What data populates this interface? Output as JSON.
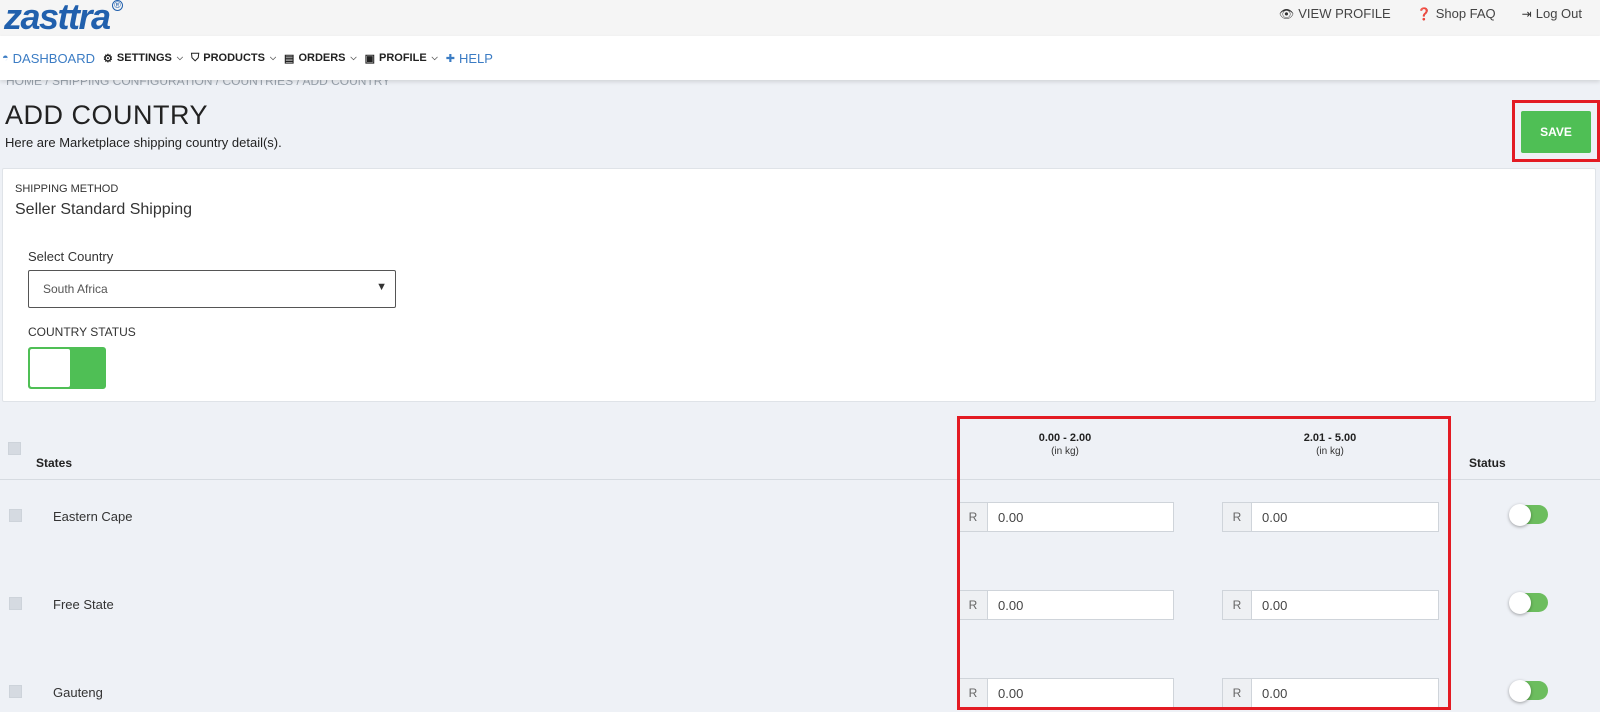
{
  "brand": {
    "name": "zasttra",
    "mark": "®"
  },
  "top_links": [
    {
      "icon": "eye-icon",
      "label": "VIEW PROFILE"
    },
    {
      "icon": "question-circle-icon",
      "label": "Shop FAQ"
    },
    {
      "icon": "logout-icon",
      "label": "Log Out"
    }
  ],
  "nav": {
    "dashboard": "DASHBOARD",
    "settings": "SETTINGS",
    "products": "PRODUCTS",
    "orders": "ORDERS",
    "profile": "PROFILE",
    "help": "HELP"
  },
  "breadcrumb": "HOME / SHIPPING CONFIGURATION / COUNTRIES / ADD COUNTRY",
  "page": {
    "title": "ADD COUNTRY",
    "subtitle": "Here are Marketplace shipping country detail(s).",
    "save_label": "SAVE"
  },
  "form": {
    "shipping_method_label": "SHIPPING METHOD",
    "shipping_method_value": "Seller Standard Shipping",
    "select_country_label": "Select Country",
    "selected_country": "South Africa",
    "country_status_label": "COUNTRY STATUS",
    "country_status_on": true
  },
  "table": {
    "states_header": "States",
    "status_header": "Status",
    "ranges": [
      {
        "range": "0.00 - 2.00",
        "unit": "(in kg)"
      },
      {
        "range": "2.01 - 5.00",
        "unit": "(in kg)"
      }
    ],
    "currency_prefix": "R",
    "rows": [
      {
        "state": "Eastern Cape",
        "rate_1": "0.00",
        "rate_2": "0.00"
      },
      {
        "state": "Free State",
        "rate_1": "0.00",
        "rate_2": "0.00"
      },
      {
        "state": "Gauteng",
        "rate_1": "0.00",
        "rate_2": "0.00"
      }
    ]
  },
  "colors": {
    "brand_blue": "#2160ad",
    "save_green": "#4fbf55",
    "highlight_red": "#e31b23",
    "toggle_green": "#6cbd5e"
  }
}
